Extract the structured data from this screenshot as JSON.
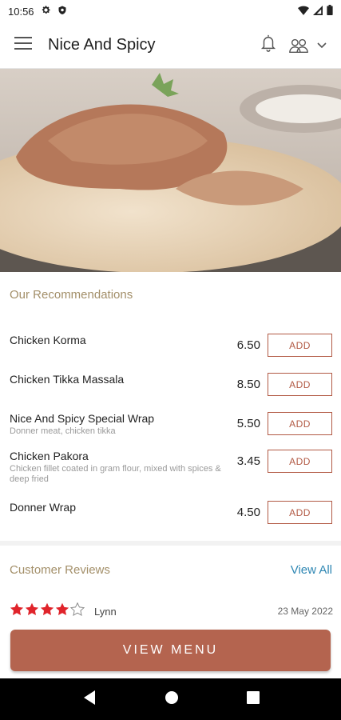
{
  "status_bar": {
    "time": "10:56"
  },
  "app_bar": {
    "title": "Nice And Spicy"
  },
  "recommendations": {
    "title": "Our Recommendations",
    "items": [
      {
        "name": "Chicken Korma",
        "description": "",
        "price": "6.50",
        "add_label": "ADD"
      },
      {
        "name": "Chicken Tikka Massala",
        "description": "",
        "price": "8.50",
        "add_label": "ADD"
      },
      {
        "name": "Nice And Spicy Special Wrap",
        "description": "Donner meat, chicken tikka",
        "price": "5.50",
        "add_label": "ADD"
      },
      {
        "name": "Chicken Pakora",
        "description": "Chicken fillet coated in gram flour, mixed with spices & deep fried",
        "price": "3.45",
        "add_label": "ADD"
      },
      {
        "name": "Donner Wrap",
        "description": "",
        "price": "4.50",
        "add_label": "ADD"
      }
    ]
  },
  "reviews": {
    "title": "Customer Reviews",
    "view_all_label": "View All",
    "items": [
      {
        "rating": 4,
        "max_rating": 5,
        "reviewer": "Lynn",
        "date": "23 May 2022"
      }
    ]
  },
  "view_menu_label": "VIEW MENU",
  "colors": {
    "accent": "#b4644f",
    "section_title": "#a38f69",
    "link": "#2f87b3",
    "star": "#e0242b"
  },
  "icons": [
    "settings-icon",
    "shield-icon",
    "wifi-icon",
    "signal-icon",
    "battery-icon",
    "menu-icon",
    "bell-icon",
    "users-icon",
    "chevron-down-icon",
    "back-icon",
    "home-icon",
    "recents-icon"
  ]
}
